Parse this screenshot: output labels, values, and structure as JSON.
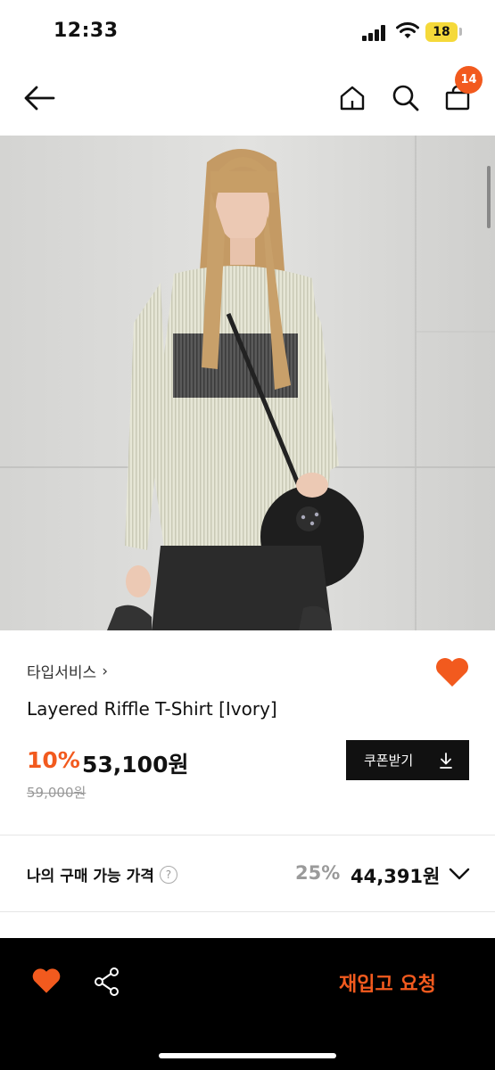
{
  "status_bar": {
    "time": "12:33",
    "battery": "18"
  },
  "nav": {
    "cart_count": "14"
  },
  "product": {
    "brand": "타입서비스",
    "brand_chevron": "›",
    "name": "Layered Riffle T-Shirt [Ivory]",
    "discount": "10%",
    "price": "53,100원",
    "original_price": "59,000원",
    "coupon_label": "쿠폰받기",
    "liked": true
  },
  "my_price": {
    "label": "나의 구매 가능 가격",
    "help_icon": "?",
    "discount": "25%",
    "price": "44,391원"
  },
  "bottom_bar": {
    "restock_label": "재입고 요청"
  },
  "icons": [
    "back-arrow-icon",
    "home-icon",
    "search-icon",
    "shopping-bag-icon",
    "heart-icon",
    "download-icon",
    "chevron-down-icon",
    "share-icon",
    "help-icon"
  ],
  "colors": {
    "accent": "#f25a1e",
    "dark": "#111111",
    "battery": "#f5d93a"
  }
}
